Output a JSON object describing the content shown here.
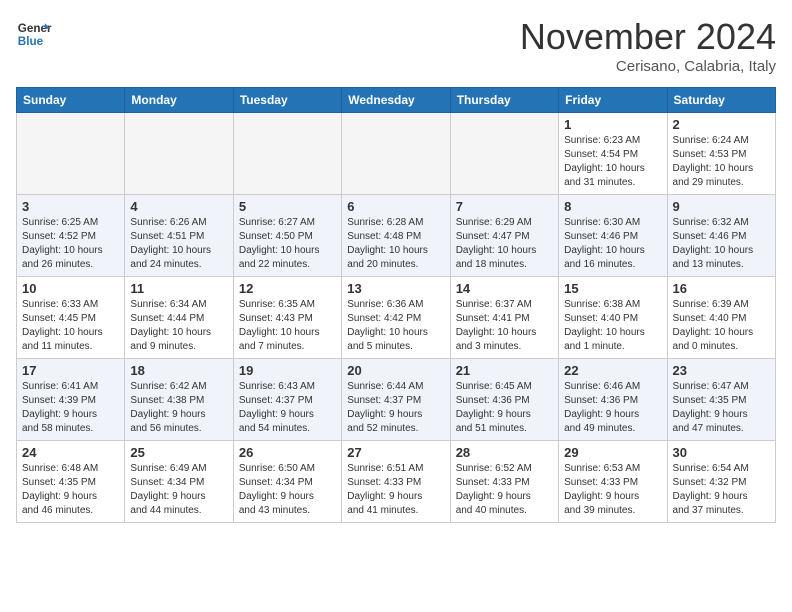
{
  "header": {
    "logo_line1": "General",
    "logo_line2": "Blue",
    "month": "November 2024",
    "location": "Cerisano, Calabria, Italy"
  },
  "weekdays": [
    "Sunday",
    "Monday",
    "Tuesday",
    "Wednesday",
    "Thursday",
    "Friday",
    "Saturday"
  ],
  "weeks": [
    [
      {
        "day": "",
        "info": ""
      },
      {
        "day": "",
        "info": ""
      },
      {
        "day": "",
        "info": ""
      },
      {
        "day": "",
        "info": ""
      },
      {
        "day": "",
        "info": ""
      },
      {
        "day": "1",
        "info": "Sunrise: 6:23 AM\nSunset: 4:54 PM\nDaylight: 10 hours\nand 31 minutes."
      },
      {
        "day": "2",
        "info": "Sunrise: 6:24 AM\nSunset: 4:53 PM\nDaylight: 10 hours\nand 29 minutes."
      }
    ],
    [
      {
        "day": "3",
        "info": "Sunrise: 6:25 AM\nSunset: 4:52 PM\nDaylight: 10 hours\nand 26 minutes."
      },
      {
        "day": "4",
        "info": "Sunrise: 6:26 AM\nSunset: 4:51 PM\nDaylight: 10 hours\nand 24 minutes."
      },
      {
        "day": "5",
        "info": "Sunrise: 6:27 AM\nSunset: 4:50 PM\nDaylight: 10 hours\nand 22 minutes."
      },
      {
        "day": "6",
        "info": "Sunrise: 6:28 AM\nSunset: 4:48 PM\nDaylight: 10 hours\nand 20 minutes."
      },
      {
        "day": "7",
        "info": "Sunrise: 6:29 AM\nSunset: 4:47 PM\nDaylight: 10 hours\nand 18 minutes."
      },
      {
        "day": "8",
        "info": "Sunrise: 6:30 AM\nSunset: 4:46 PM\nDaylight: 10 hours\nand 16 minutes."
      },
      {
        "day": "9",
        "info": "Sunrise: 6:32 AM\nSunset: 4:46 PM\nDaylight: 10 hours\nand 13 minutes."
      }
    ],
    [
      {
        "day": "10",
        "info": "Sunrise: 6:33 AM\nSunset: 4:45 PM\nDaylight: 10 hours\nand 11 minutes."
      },
      {
        "day": "11",
        "info": "Sunrise: 6:34 AM\nSunset: 4:44 PM\nDaylight: 10 hours\nand 9 minutes."
      },
      {
        "day": "12",
        "info": "Sunrise: 6:35 AM\nSunset: 4:43 PM\nDaylight: 10 hours\nand 7 minutes."
      },
      {
        "day": "13",
        "info": "Sunrise: 6:36 AM\nSunset: 4:42 PM\nDaylight: 10 hours\nand 5 minutes."
      },
      {
        "day": "14",
        "info": "Sunrise: 6:37 AM\nSunset: 4:41 PM\nDaylight: 10 hours\nand 3 minutes."
      },
      {
        "day": "15",
        "info": "Sunrise: 6:38 AM\nSunset: 4:40 PM\nDaylight: 10 hours\nand 1 minute."
      },
      {
        "day": "16",
        "info": "Sunrise: 6:39 AM\nSunset: 4:40 PM\nDaylight: 10 hours\nand 0 minutes."
      }
    ],
    [
      {
        "day": "17",
        "info": "Sunrise: 6:41 AM\nSunset: 4:39 PM\nDaylight: 9 hours\nand 58 minutes."
      },
      {
        "day": "18",
        "info": "Sunrise: 6:42 AM\nSunset: 4:38 PM\nDaylight: 9 hours\nand 56 minutes."
      },
      {
        "day": "19",
        "info": "Sunrise: 6:43 AM\nSunset: 4:37 PM\nDaylight: 9 hours\nand 54 minutes."
      },
      {
        "day": "20",
        "info": "Sunrise: 6:44 AM\nSunset: 4:37 PM\nDaylight: 9 hours\nand 52 minutes."
      },
      {
        "day": "21",
        "info": "Sunrise: 6:45 AM\nSunset: 4:36 PM\nDaylight: 9 hours\nand 51 minutes."
      },
      {
        "day": "22",
        "info": "Sunrise: 6:46 AM\nSunset: 4:36 PM\nDaylight: 9 hours\nand 49 minutes."
      },
      {
        "day": "23",
        "info": "Sunrise: 6:47 AM\nSunset: 4:35 PM\nDaylight: 9 hours\nand 47 minutes."
      }
    ],
    [
      {
        "day": "24",
        "info": "Sunrise: 6:48 AM\nSunset: 4:35 PM\nDaylight: 9 hours\nand 46 minutes."
      },
      {
        "day": "25",
        "info": "Sunrise: 6:49 AM\nSunset: 4:34 PM\nDaylight: 9 hours\nand 44 minutes."
      },
      {
        "day": "26",
        "info": "Sunrise: 6:50 AM\nSunset: 4:34 PM\nDaylight: 9 hours\nand 43 minutes."
      },
      {
        "day": "27",
        "info": "Sunrise: 6:51 AM\nSunset: 4:33 PM\nDaylight: 9 hours\nand 41 minutes."
      },
      {
        "day": "28",
        "info": "Sunrise: 6:52 AM\nSunset: 4:33 PM\nDaylight: 9 hours\nand 40 minutes."
      },
      {
        "day": "29",
        "info": "Sunrise: 6:53 AM\nSunset: 4:33 PM\nDaylight: 9 hours\nand 39 minutes."
      },
      {
        "day": "30",
        "info": "Sunrise: 6:54 AM\nSunset: 4:32 PM\nDaylight: 9 hours\nand 37 minutes."
      }
    ]
  ]
}
